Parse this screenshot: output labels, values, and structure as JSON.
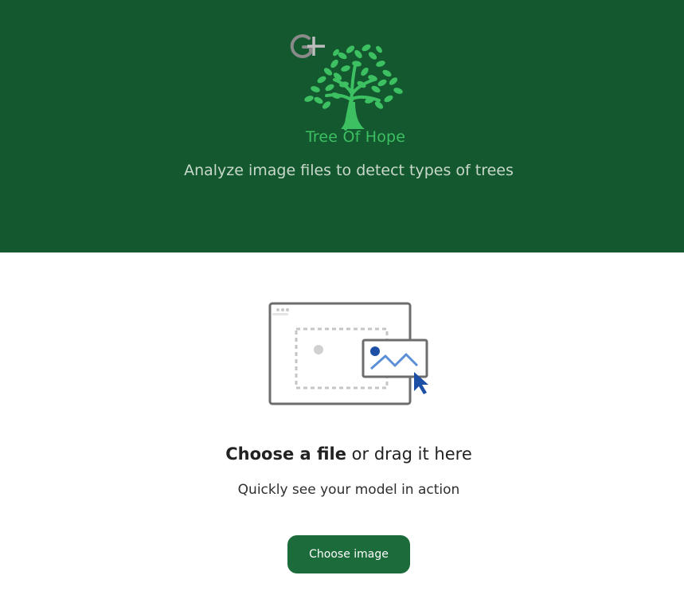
{
  "header": {
    "brand_name": "Tree Of Hope",
    "tagline": "Analyze image files to detect types of trees",
    "logo_icon": "tree-icon",
    "badge_icon": "g-plus-icon",
    "background_color": "#13582e",
    "brand_color": "#3cc062"
  },
  "upload": {
    "illustration_icon": "image-upload-illustration-icon",
    "headline_strong": "Choose a file",
    "headline_rest": " or drag it here",
    "subtitle": "Quickly see your model in action",
    "button_label": "Choose image",
    "button_color": "#1c6b3a"
  }
}
